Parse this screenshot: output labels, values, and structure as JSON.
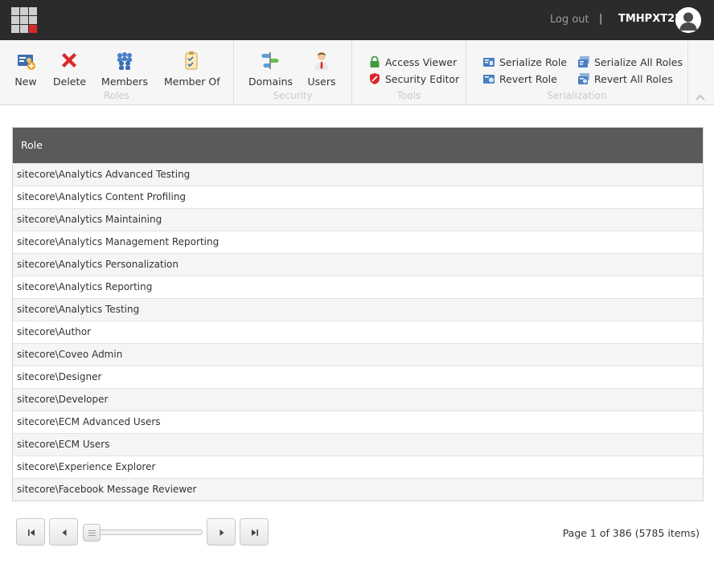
{
  "topbar": {
    "logout_label": "Log out",
    "separator": "|",
    "username": "TMHPXT22"
  },
  "ribbon": {
    "roles": {
      "label": "Roles",
      "new_label": "New",
      "delete_label": "Delete",
      "members_label": "Members",
      "member_of_label": "Member Of"
    },
    "security": {
      "label": "Security",
      "domains_label": "Domains",
      "users_label": "Users"
    },
    "tools": {
      "label": "Tools",
      "access_viewer_label": "Access Viewer",
      "security_editor_label": "Security Editor"
    },
    "serialization": {
      "label": "Serialization",
      "serialize_role_label": "Serialize Role",
      "revert_role_label": "Revert Role",
      "serialize_all_label": "Serialize All Roles",
      "revert_all_label": "Revert All Roles"
    }
  },
  "table": {
    "header": "Role",
    "rows": [
      "sitecore\\Analytics Advanced Testing",
      "sitecore\\Analytics Content Profiling",
      "sitecore\\Analytics Maintaining",
      "sitecore\\Analytics Management Reporting",
      "sitecore\\Analytics Personalization",
      "sitecore\\Analytics Reporting",
      "sitecore\\Analytics Testing",
      "sitecore\\Author",
      "sitecore\\Coveo Admin",
      "sitecore\\Designer",
      "sitecore\\Developer",
      "sitecore\\ECM Advanced Users",
      "sitecore\\ECM Users",
      "sitecore\\Experience Explorer",
      "sitecore\\Facebook Message Reviewer"
    ]
  },
  "pager": {
    "info": "Page 1 of 386 (5785 items)"
  },
  "colors": {
    "topbar_bg": "#2b2b2b",
    "grid_header_bg": "#5a5a5a",
    "accent_red": "#d9292c"
  },
  "icons": [
    "launchpad-icon",
    "avatar-icon",
    "new-role-icon",
    "delete-icon",
    "members-icon",
    "member-of-icon",
    "domains-icon",
    "users-icon",
    "lock-icon",
    "shield-icon",
    "serialize-icon",
    "revert-icon",
    "collapse-chevron-icon",
    "first-page-icon",
    "prev-page-icon",
    "next-page-icon",
    "last-page-icon"
  ]
}
